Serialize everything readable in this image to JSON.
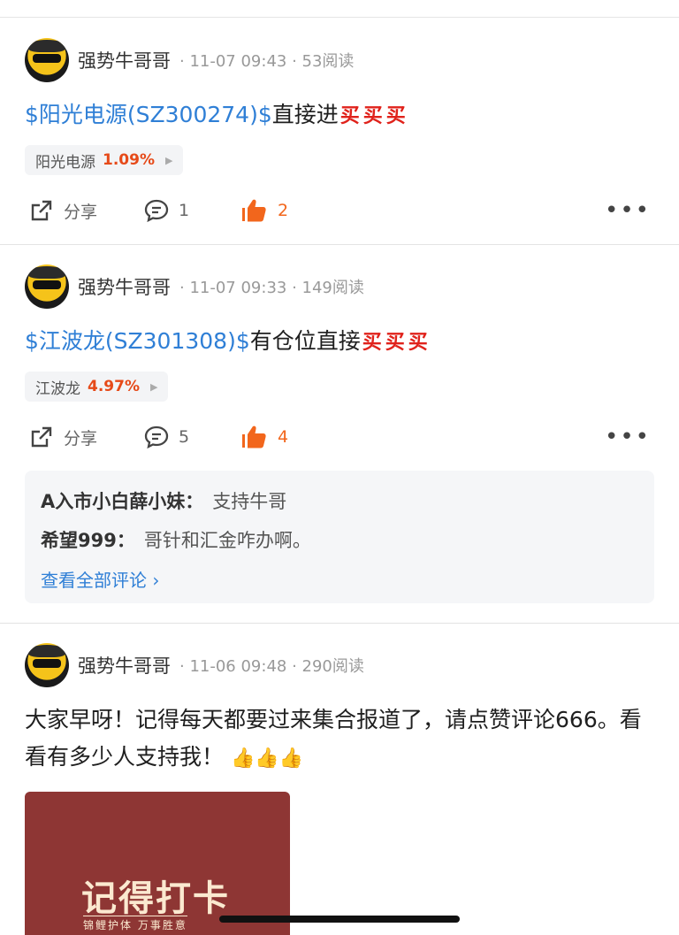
{
  "posts": [
    {
      "username": "强势牛哥哥",
      "meta": "· 11-07 09:43 · 53阅读",
      "stock_text": "$阳光电源(SZ300274)$",
      "text": "直接进",
      "buy_marks": "买买买",
      "chip_name": "阳光电源",
      "chip_pct": "1.09%",
      "share_label": "分享",
      "comments": "1",
      "likes": "2"
    },
    {
      "username": "强势牛哥哥",
      "meta": "· 11-07 09:33 · 149阅读",
      "stock_text": "$江波龙(SZ301308)$",
      "text": "有仓位直接",
      "buy_marks": "买买买",
      "chip_name": "江波龙",
      "chip_pct": "4.97%",
      "share_label": "分享",
      "comments": "5",
      "likes": "4",
      "comment_list": [
        {
          "user": "A入市小白薛小妹：",
          "text": "支持牛哥"
        },
        {
          "user": "希望999：",
          "text": "哥针和汇金咋办啊。"
        }
      ],
      "view_all": "查看全部评论 ›"
    },
    {
      "username": "强势牛哥哥",
      "meta": "· 11-06 09:48 · 290阅读",
      "text": "大家早呀！记得每天都要过来集合报道了，请点赞评论666。看看有多少人支持我！",
      "thumbs": "👍👍👍",
      "image_title": "记得打卡",
      "image_sub": "锦鲤护体 万事胜意"
    }
  ],
  "colors": {
    "link": "#2f7fd6",
    "like": "#f2661c",
    "rise": "#e64a19"
  }
}
